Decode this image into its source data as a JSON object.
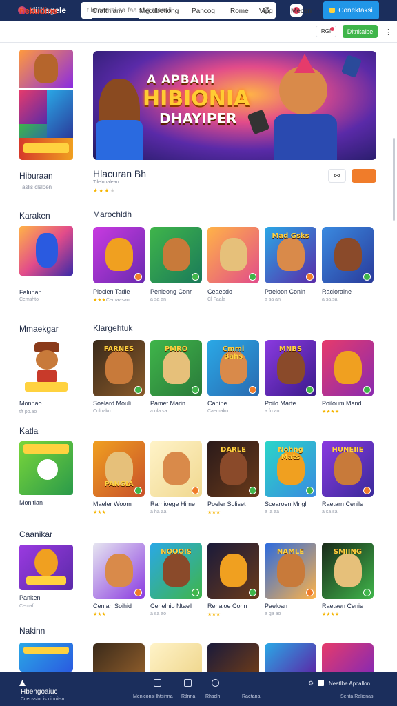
{
  "topbar": {
    "brand": "diihagele",
    "search_placeholder": "t lstaearsi sa faa sflg atasaii",
    "cta_label": "Conektaksi"
  },
  "nav": {
    "logo": "nekudine",
    "links": [
      "Crafthiam",
      "Mecdbetiong",
      "Pancog",
      "Rome",
      "Ving",
      "Mecen"
    ],
    "pill": "RGI",
    "cta_label": "Ditnkalbe",
    "more": "⋮"
  },
  "sidebar": {
    "title": "Hiburaan",
    "subtitle": "Taslis clsloen",
    "items": [
      {
        "heading": "Karaken",
        "name": "Falunan",
        "meta": "Cemshto"
      },
      {
        "heading": "Mmaekgar",
        "name": "Monnao",
        "meta": "tft pb.ao"
      },
      {
        "heading": "Katla",
        "name": "Monitian",
        "meta": ""
      },
      {
        "heading": "Caanikar",
        "name": "Panken",
        "meta": "Cemaft"
      },
      {
        "heading": "Nakinn",
        "name": "",
        "meta": ""
      }
    ]
  },
  "hero": {
    "line1": "A APBAIH",
    "line2": "HIBIONIA",
    "line3": "DHAYIPER"
  },
  "game": {
    "title": "Hlacuran Bh",
    "subtitle": "Tilelnoalean",
    "stars": "★★★"
  },
  "sections": [
    {
      "title": "Marochldh",
      "tiles": [
        {
          "name": "Pioclen Tadie",
          "meta": "Cemaasao",
          "stars": "★★★"
        },
        {
          "name": "Penleong Conr",
          "meta": "a sa an",
          "stars": ""
        },
        {
          "name": "Ceaesdo",
          "meta": "Cl Faala",
          "stars": ""
        },
        {
          "name": "Paeloon Conin",
          "meta": "a sa an",
          "stars": ""
        },
        {
          "name": "Racloraine",
          "meta": "a sa.sa",
          "stars": ""
        }
      ]
    },
    {
      "title": "Klargehtuk",
      "tiles": [
        {
          "name": "Soelard Mouli",
          "meta": "Coloakn",
          "stars": ""
        },
        {
          "name": "Pamet Marin",
          "meta": "a ola sa",
          "stars": ""
        },
        {
          "name": "Canine",
          "meta": "Caemako",
          "stars": ""
        },
        {
          "name": "Poilo Marte",
          "meta": "a fo ao",
          "stars": ""
        },
        {
          "name": "Poiloum Mand",
          "meta": "",
          "stars": "★★★★"
        }
      ]
    },
    {
      "title": "",
      "tiles": [
        {
          "name": "Maeler Woom",
          "meta": "",
          "stars": "★★★"
        },
        {
          "name": "Rarnioege Hime",
          "meta": "a ha aa",
          "stars": ""
        },
        {
          "name": "Poeler Soliset",
          "meta": "",
          "stars": "★★★"
        },
        {
          "name": "Scearoen Mrigl",
          "meta": "a la aa",
          "stars": ""
        },
        {
          "name": "Raetarn Cenils",
          "meta": "a sa sa",
          "stars": ""
        }
      ]
    },
    {
      "title": "",
      "tiles": [
        {
          "name": "Cenlan Soihid",
          "meta": "",
          "stars": "★★★"
        },
        {
          "name": "Cenelnio Ntaell",
          "meta": "a sa ao",
          "stars": ""
        },
        {
          "name": "Renaioe Conn",
          "meta": "",
          "stars": "★★★"
        },
        {
          "name": "Paeloan",
          "meta": "a ga ao",
          "stars": ""
        },
        {
          "name": "Raetaen Cenis",
          "meta": "",
          "stars": "★★★★"
        }
      ]
    }
  ],
  "tile_art": [
    [
      "",
      "",
      "",
      "Mad Gsks",
      ""
    ],
    [
      "FARNES",
      "PMRO",
      "Cmmi Bahs",
      "MNBS",
      ""
    ],
    [
      "PANGIA",
      "",
      "DARLE",
      "Nohng Mats",
      "HUNEIIE"
    ],
    [
      "",
      "NOOOIS",
      "",
      "NAMLE",
      "SMIING"
    ]
  ],
  "footer": {
    "brand": "Hbengoaiuc",
    "subtitle": "Ccecsslor is cinuitsn",
    "labels": [
      "Meniconsi lhtsinna",
      "Rtlnna",
      "Rhsclh",
      "Raetana"
    ],
    "right": "Neatlbe Apcallon",
    "right_sub": "Senta Ralionas"
  },
  "colors": {
    "topbar": "#1b2e5c",
    "accent_blue": "#2196e8",
    "accent_green": "#3fb54a",
    "accent_orange": "#f07c2a",
    "logo_red": "#e8402a"
  }
}
